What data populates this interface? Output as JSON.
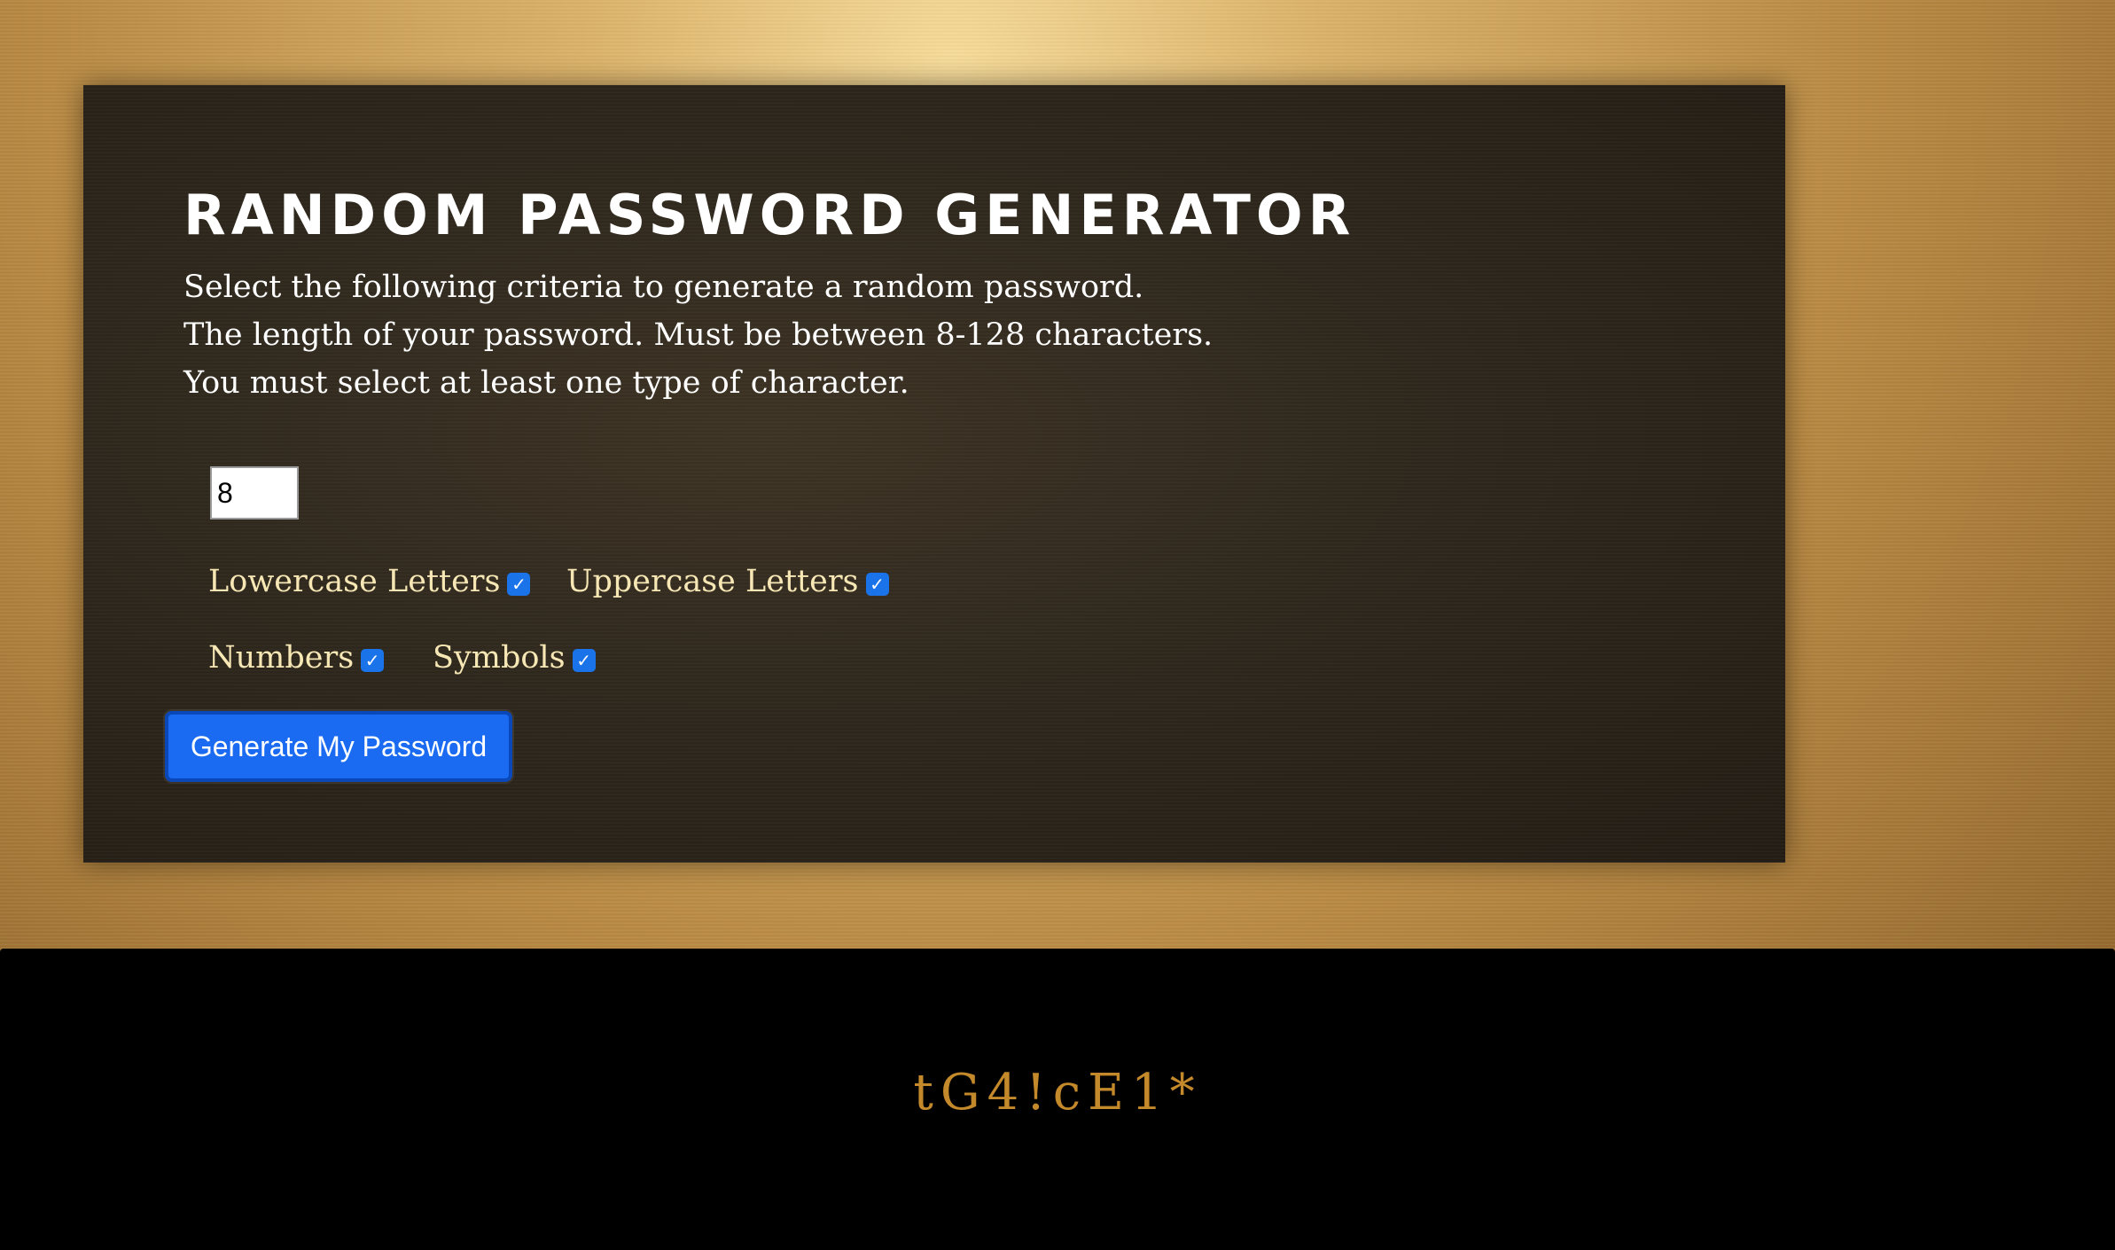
{
  "app": {
    "title": "Random Password Generator"
  },
  "instructions": {
    "line1": "Select the following criteria to generate a random password.",
    "line2": "The length of your password. Must be between 8-128 characters.",
    "line3": "You must select at least one type of character."
  },
  "length_input": {
    "value": "8"
  },
  "options": {
    "lowercase": {
      "label": "Lowercase Letters",
      "checked": true
    },
    "uppercase": {
      "label": "Uppercase Letters",
      "checked": true
    },
    "numbers": {
      "label": "Numbers",
      "checked": true
    },
    "symbols": {
      "label": "Symbols",
      "checked": true
    }
  },
  "generate_button": {
    "label": "Generate My Password"
  },
  "output": {
    "password": "tG4!cE1*"
  },
  "colors": {
    "accent_blue": "#1a6bf2",
    "option_label": "#f7e7b5",
    "password_text": "#c4892a"
  }
}
